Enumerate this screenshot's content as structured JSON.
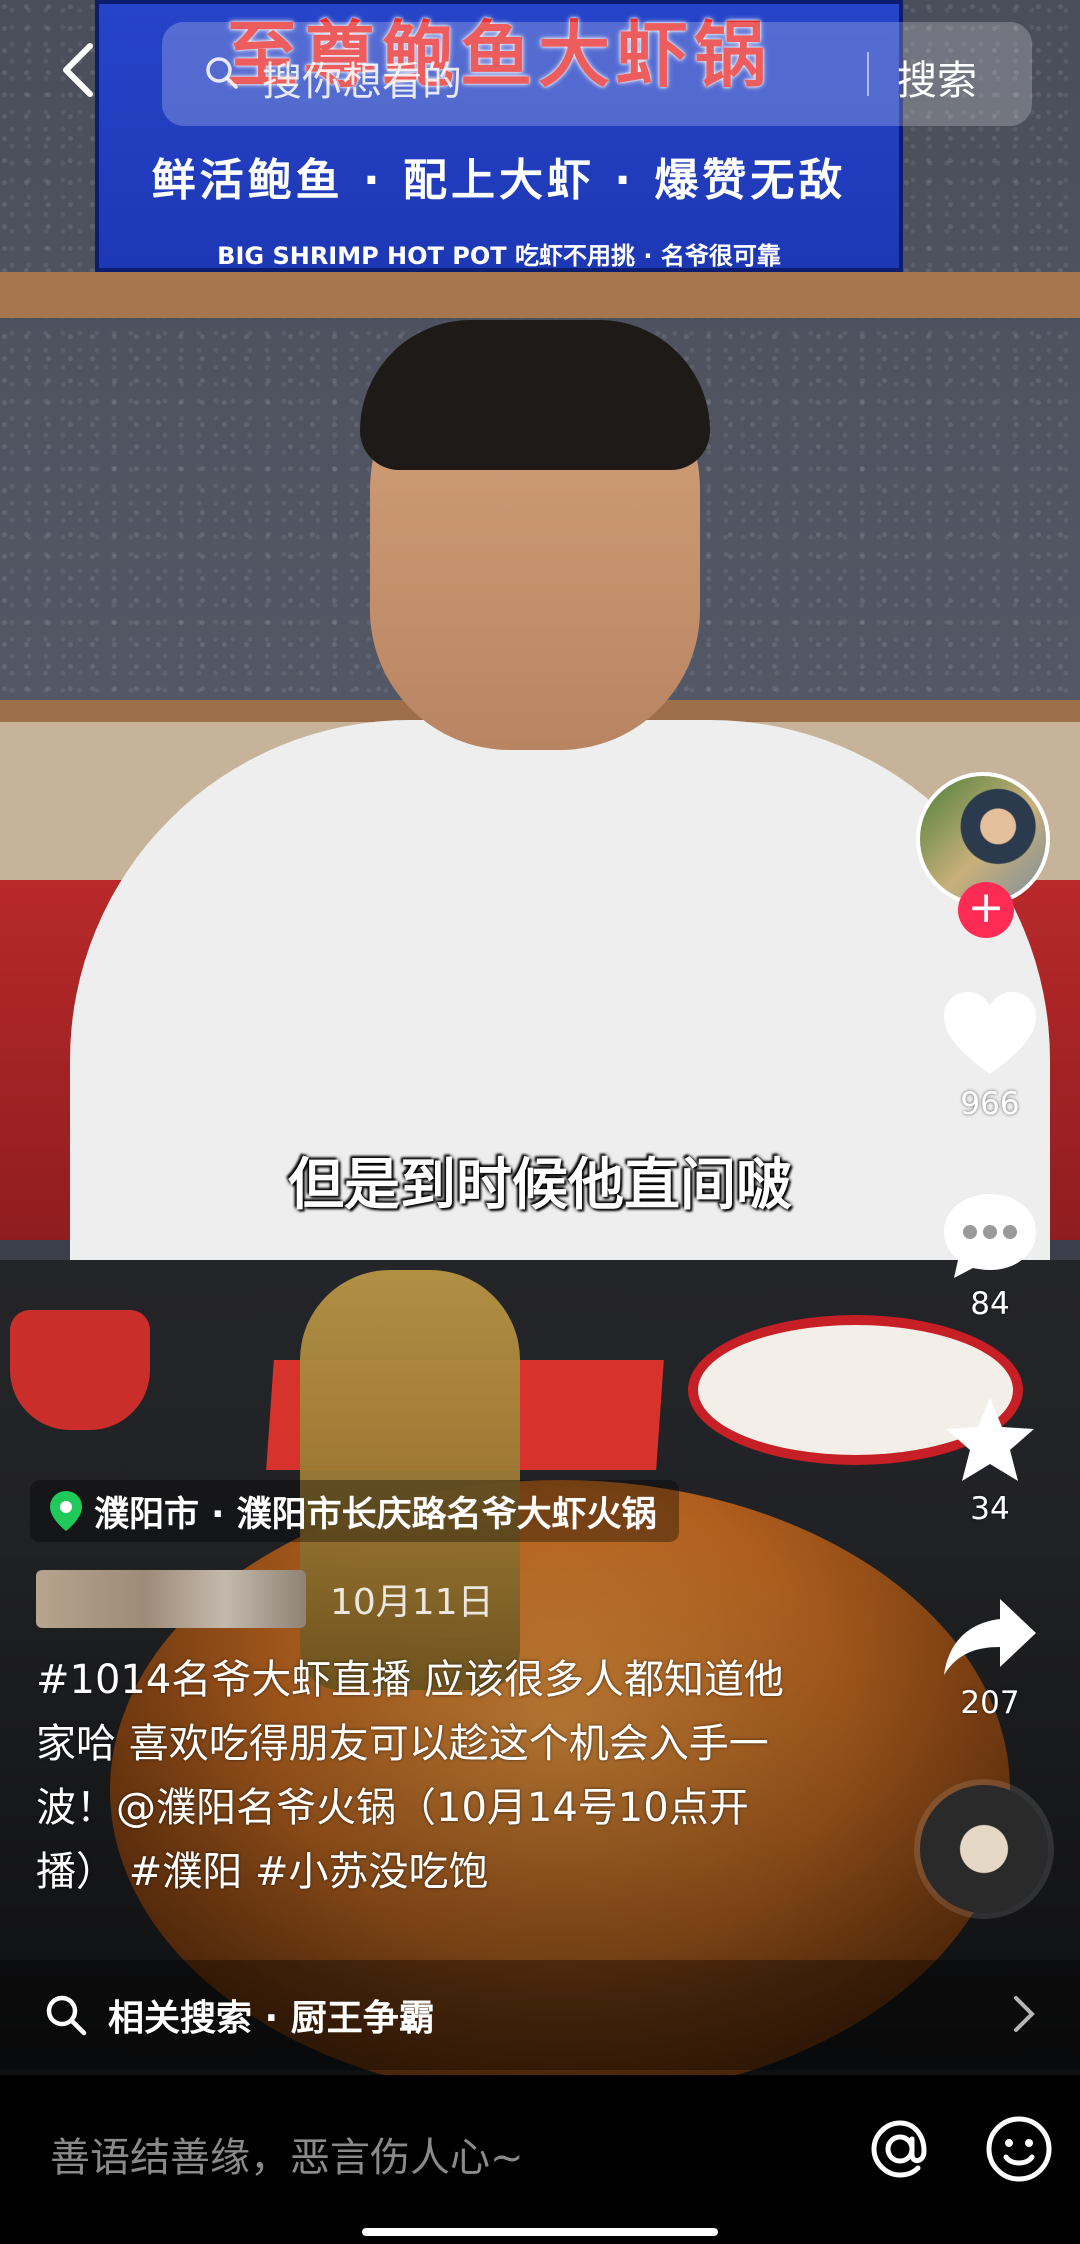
{
  "sign": {
    "title": "至尊鲍鱼大虾锅",
    "subtitle": "鲜活鲍鱼 · 配上大虾 · 爆赞无敌",
    "small": "BIG SHRIMP HOT POT 吃虾不用挑 · 名爷很可靠"
  },
  "topbar": {
    "search_placeholder": "搜你想看的",
    "search_button": "搜索"
  },
  "video": {
    "subtitle": "但是到时候他直间啵"
  },
  "rail": {
    "likes": "966",
    "comments": "84",
    "favorites": "34",
    "shares": "207"
  },
  "info": {
    "location": "濮阳市 · 濮阳市长庆路名爷大虾火锅",
    "author": "@",
    "date": "10月11日",
    "description": "#1014名爷大虾直播 应该很多人都知道他家哈 喜欢吃得朋友可以趁这个机会入手一波！@濮阳名爷火锅（10月14号10点开播） #濮阳 #小苏没吃饱",
    "related": "相关搜索 · 厨王争霸"
  },
  "comment": {
    "placeholder": "善语结善缘，恶言伤人心~"
  },
  "colors": {
    "accent": "#fe2c55",
    "location_pin": "#1fc95a"
  }
}
